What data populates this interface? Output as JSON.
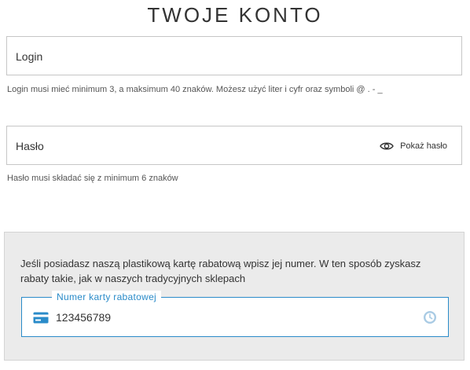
{
  "page": {
    "title": "TWOJE KONTO"
  },
  "login": {
    "label": "Login",
    "hint": "Login musi mieć minimum 3, a maksimum 40 znaków. Możesz użyć liter i cyfr oraz symboli @ . - _"
  },
  "password": {
    "label": "Hasło",
    "show_label": "Pokaż hasło",
    "show_icon": "eye-icon",
    "hint": "Hasło musi składać się z minimum 6 znaków"
  },
  "loyalty_card": {
    "info": "Jeśli posiadasz naszą plastikową kartę rabatową wpisz jej numer. W ten sposób zyskasz rabaty takie, jak w naszych tradycyjnych sklepach",
    "legend": "Numer karty rabatowej",
    "value": "123456789",
    "card_icon": "credit-card-icon",
    "status_icon": "clock-icon"
  },
  "colors": {
    "accent": "#2a8bc9",
    "panel_bg": "#ebebeb",
    "border": "#c6c6c6",
    "status_icon": "#a9cbe4"
  }
}
